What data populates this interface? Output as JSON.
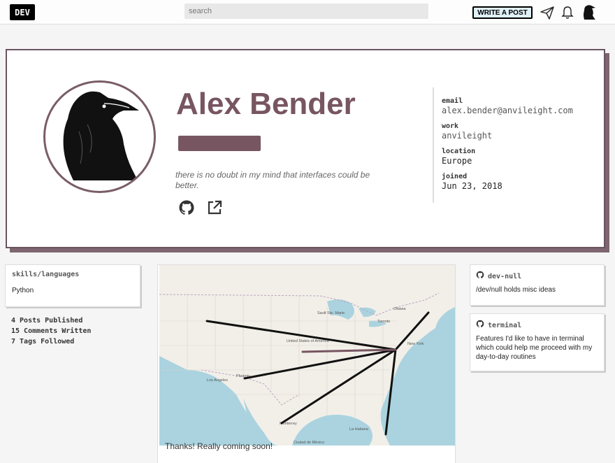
{
  "topbar": {
    "logo": "DEV",
    "search_placeholder": "search",
    "write_post": "WRITE A POST",
    "icons": [
      "paper-plane-icon",
      "bell-icon",
      "user-avatar-icon"
    ]
  },
  "profile": {
    "name": "Alex Bender",
    "summary": "there is no doubt in my mind that interfaces could be better.",
    "links": [
      "github-icon",
      "external-link-icon"
    ],
    "meta": [
      {
        "key": "email",
        "value": "alex.bender@anvileight.com"
      },
      {
        "key": "work",
        "value": "anvileight"
      },
      {
        "key": "location",
        "value": "Europe"
      },
      {
        "key": "joined",
        "value": "Jun 23, 2018"
      }
    ],
    "accent_color": "#775661"
  },
  "sidebar": {
    "skills_title": "skills/languages",
    "skills": [
      "Python"
    ],
    "stats": [
      "4 Posts Published",
      "15 Comments Written",
      "7 Tags Followed"
    ]
  },
  "map": {
    "labels": [
      "Sault Ste. Marie",
      "Ottawa",
      "Toronto",
      "New York",
      "United States of America",
      "Los Angeles",
      "Phoenix",
      "Monterrey",
      "Ciudad de México",
      "La Habana"
    ]
  },
  "feed": {
    "comment_snippet": "Thanks! Really coming soon!"
  },
  "repos": [
    {
      "name": "dev-null",
      "description": "/dev/null holds misc ideas"
    },
    {
      "name": "terminal",
      "description": "Features I'd like to have in terminal which could help me proceed with my day-to-day routines"
    }
  ]
}
